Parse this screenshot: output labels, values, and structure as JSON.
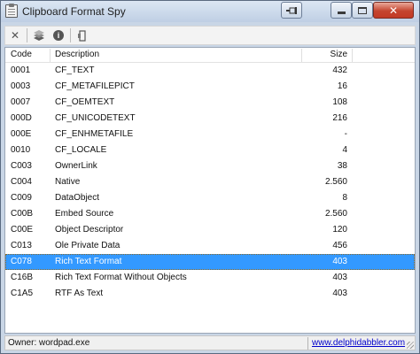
{
  "window": {
    "title": "Clipboard Format Spy",
    "close_glyph": "✕"
  },
  "toolbar": {
    "items": [
      "close-icon",
      "books-icon",
      "info-icon",
      "pin-icon"
    ],
    "clear_glyph": "✕",
    "info_glyph": "i"
  },
  "list": {
    "columns": [
      "Code",
      "Description",
      "Size"
    ],
    "rows": [
      {
        "code": "0001",
        "description": "CF_TEXT",
        "size": "432"
      },
      {
        "code": "0003",
        "description": "CF_METAFILEPICT",
        "size": "16"
      },
      {
        "code": "0007",
        "description": "CF_OEMTEXT",
        "size": "108"
      },
      {
        "code": "000D",
        "description": "CF_UNICODETEXT",
        "size": "216"
      },
      {
        "code": "000E",
        "description": "CF_ENHMETAFILE",
        "size": "-"
      },
      {
        "code": "0010",
        "description": "CF_LOCALE",
        "size": "4"
      },
      {
        "code": "C003",
        "description": "OwnerLink",
        "size": "38"
      },
      {
        "code": "C004",
        "description": "Native",
        "size": "2.560"
      },
      {
        "code": "C009",
        "description": "DataObject",
        "size": "8"
      },
      {
        "code": "C00B",
        "description": "Embed Source",
        "size": "2.560"
      },
      {
        "code": "C00E",
        "description": "Object Descriptor",
        "size": "120"
      },
      {
        "code": "C013",
        "description": "Ole Private Data",
        "size": "456"
      },
      {
        "code": "C078",
        "description": "Rich Text Format",
        "size": "403"
      },
      {
        "code": "C16B",
        "description": "Rich Text Format Without Objects",
        "size": "403"
      },
      {
        "code": "C1A5",
        "description": "RTF As Text",
        "size": "403"
      }
    ],
    "selected_index": 12
  },
  "status": {
    "owner": "Owner: wordpad.exe",
    "link": "www.delphidabbler.com"
  },
  "colors": {
    "selection": "#3399ff",
    "link": "#0000cc",
    "close_button": "#c5452f"
  }
}
